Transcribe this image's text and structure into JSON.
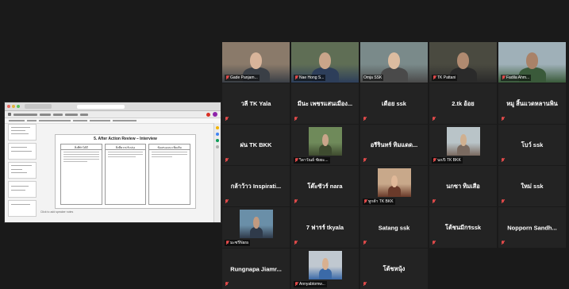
{
  "shared_screen": {
    "slide_title": "5. After Action Review – Interview",
    "column_headers": [
      "สิ่งที่ทำได้ดี",
      "สิ่งที่ควรปรับปรุง",
      "ข้อเสนอแนะเพิ่มเติม"
    ],
    "speaker_notes": "Click to add speaker notes"
  },
  "participants": [
    {
      "id": "p1",
      "name": "Gade Panjam...",
      "video": true,
      "muted": true
    },
    {
      "id": "p2",
      "name": "Nae Hong S...",
      "video": true,
      "muted": true
    },
    {
      "id": "p3",
      "name": "Omja SSK",
      "video": true,
      "muted": false
    },
    {
      "id": "p4",
      "name": "TK Pattani",
      "video": true,
      "muted": true,
      "active": true
    },
    {
      "id": "p5",
      "name": "Fadila Ahm...",
      "video": true,
      "muted": true
    },
    {
      "id": "p6",
      "name": "วลี TK Yala",
      "video": false,
      "muted": true
    },
    {
      "id": "p7",
      "name": "มีนะ เพชรแสนเมือง...",
      "video": false,
      "muted": true
    },
    {
      "id": "p8",
      "name": "เดือย ssk",
      "video": false,
      "muted": true
    },
    {
      "id": "p9",
      "name": "2.tk อ้อย",
      "video": false,
      "muted": true
    },
    {
      "id": "p10",
      "name": "หมู สิ้นแวดหลานพิน",
      "video": false,
      "muted": true
    },
    {
      "id": "p11",
      "name": "ฝน TK BKK",
      "video": false,
      "muted": true
    },
    {
      "id": "p12",
      "name": "วิลาวัณย์ ชัยยะ...",
      "video": true,
      "muted": true
    },
    {
      "id": "p13",
      "name": "อรีรินทร์ ทิมแดด...",
      "video": false,
      "muted": true
    },
    {
      "id": "p14",
      "name": "นก/5 TK BKK",
      "video": true,
      "muted": true
    },
    {
      "id": "p15",
      "name": "โบว์ ssk",
      "video": false,
      "muted": true
    },
    {
      "id": "p16",
      "name": "กล้าว้าว Inspirati...",
      "video": false,
      "muted": true
    },
    {
      "id": "p17",
      "name": "โต๊ะซัวร์ nara",
      "video": false,
      "muted": true
    },
    {
      "id": "p18",
      "name": "ทูกต้า TK BKK",
      "video": true,
      "muted": true
    },
    {
      "id": "p19",
      "name": "นกซา ทิมเสือ",
      "video": false,
      "muted": true
    },
    {
      "id": "p20",
      "name": "ใหม่ ssk",
      "video": false,
      "muted": true
    },
    {
      "id": "p21",
      "name": "มะซรีNara",
      "video": true,
      "muted": true
    },
    {
      "id": "p22",
      "name": "7 ฟารร์ tkyala",
      "video": false,
      "muted": true
    },
    {
      "id": "p23",
      "name": "Satang ssk",
      "video": false,
      "muted": true
    },
    {
      "id": "p24",
      "name": "โต้ชนมีกรssk",
      "video": false,
      "muted": true
    },
    {
      "id": "p25",
      "name": "Nopporn Sandh...",
      "video": false,
      "muted": true
    },
    {
      "id": "p26",
      "name": "Rungnapa Jiamr...",
      "video": false,
      "muted": true
    },
    {
      "id": "p27",
      "name": "Annyabtomw...",
      "video": true,
      "muted": true
    },
    {
      "id": "p28",
      "name": "โต้ชหนุ้ง",
      "video": false,
      "muted": true
    }
  ],
  "colors": {
    "background": "#1a1a1a",
    "tile": "#232323",
    "active_border": "#d7d755",
    "muted": "#e04a4a"
  }
}
